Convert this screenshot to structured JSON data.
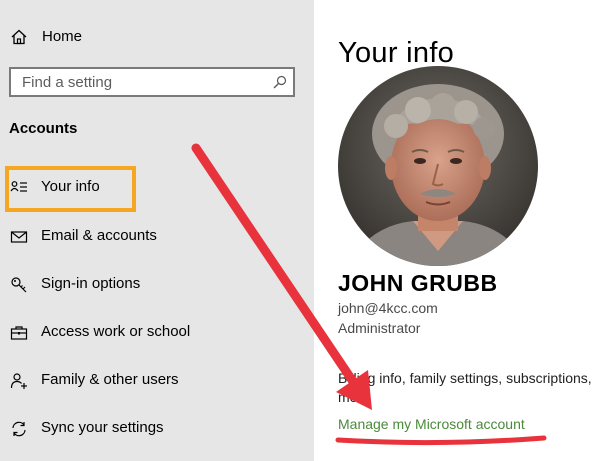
{
  "sidebar": {
    "home_label": "Home",
    "search_placeholder": "Find a setting",
    "section_title": "Accounts",
    "items": [
      {
        "label": "Your info",
        "icon": "your-info-icon",
        "selected": true
      },
      {
        "label": "Email & accounts",
        "icon": "mail-icon"
      },
      {
        "label": "Sign-in options",
        "icon": "key-icon"
      },
      {
        "label": "Access work or school",
        "icon": "briefcase-icon"
      },
      {
        "label": "Family & other users",
        "icon": "person-add-icon"
      },
      {
        "label": "Sync your settings",
        "icon": "sync-icon"
      }
    ]
  },
  "main": {
    "title": "Your info",
    "user_name": "JOHN GRUBB",
    "email": "john@4kcc.com",
    "role": "Administrator",
    "billing_line1": "Billing info, family settings, subscriptions,",
    "billing_line2": "more",
    "manage_link": "Manage my Microsoft account"
  },
  "colors": {
    "sidebar_bg": "#e6e6e6",
    "selection_outline": "#f5a623",
    "link_green": "#4b8a3a",
    "annotation_red": "#e8323c"
  }
}
